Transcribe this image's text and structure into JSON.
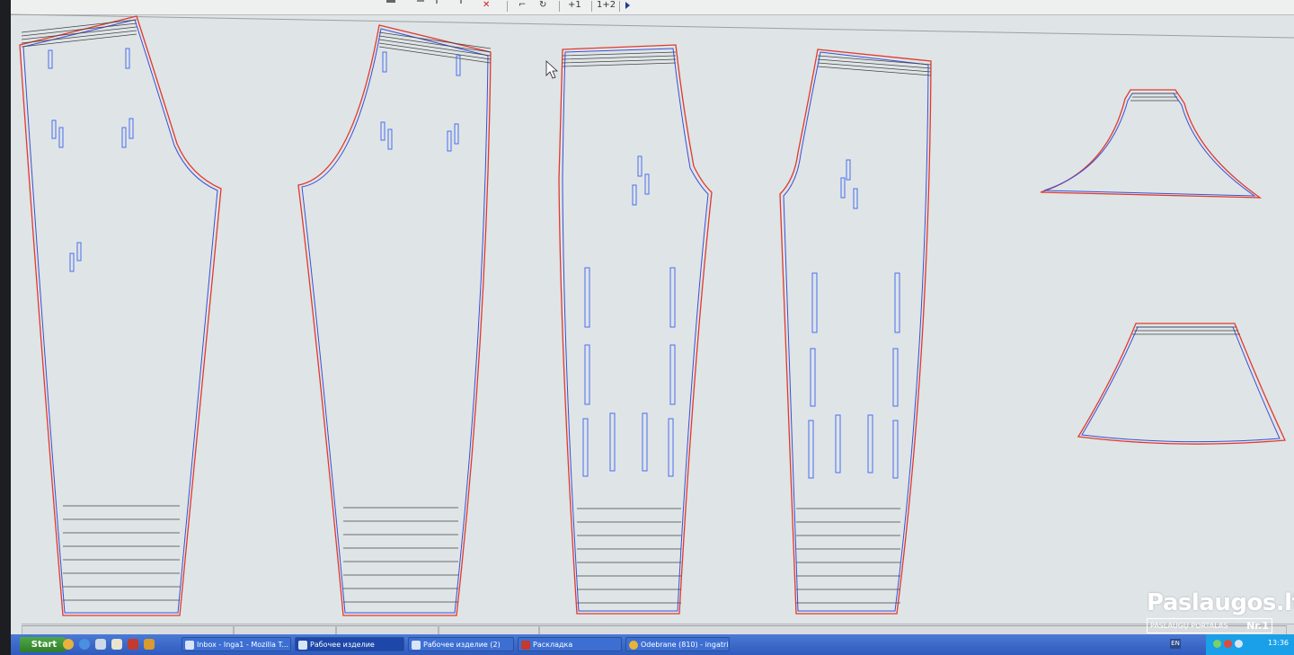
{
  "toolbar": {
    "buttons": [
      {
        "id": "tb-plus1",
        "label": "+1"
      },
      {
        "id": "tb-1plus2",
        "label": "1+2"
      }
    ]
  },
  "taskbar": {
    "start_label": "Start",
    "tasks": [
      {
        "label": "Inbox - Inga1 - Mozilla T...",
        "active": false
      },
      {
        "label": "Рабочее изделие",
        "active": true
      },
      {
        "label": "Рабочее изделие (2)",
        "active": false
      },
      {
        "label": "Раскладка",
        "active": false
      },
      {
        "label": "Odebrane (810) - ingatri...",
        "active": false
      }
    ],
    "tray": {
      "language": "EN",
      "clock": "13:36"
    }
  },
  "watermark": {
    "title": "Paslaugos.lt",
    "subtitle": "PASLAUGŲ PORTALAS",
    "badge": "Nr.1"
  },
  "colors": {
    "canvas_bg": "#dfe4e6",
    "outline_red": "#e03a2e",
    "outline_blue": "#3a4fd6",
    "grade_gray": "#555555",
    "marker_blue": "#4a6ef0"
  }
}
